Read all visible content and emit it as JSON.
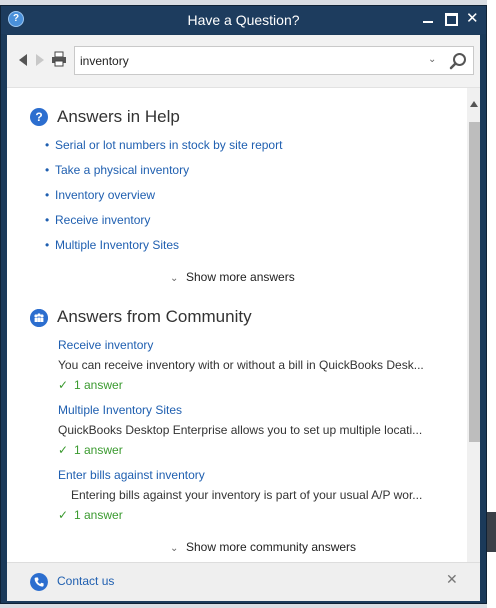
{
  "window": {
    "title": "Have a Question?",
    "app_icon": "?",
    "close_glyph": "✕"
  },
  "toolbar": {
    "search_value": "inventory",
    "dropdown_glyph": "⌄"
  },
  "help": {
    "icon": "?",
    "title": "Answers in Help",
    "bullet": "•",
    "items": [
      {
        "label": "Serial or lot numbers in stock by site report"
      },
      {
        "label": "Take a physical inventory"
      },
      {
        "label": "Inventory overview"
      },
      {
        "label": "Receive inventory"
      },
      {
        "label": "Multiple Inventory Sites"
      }
    ],
    "show_more": "Show more answers"
  },
  "community": {
    "title": "Answers from Community",
    "answer_check": "✓",
    "items": [
      {
        "title": "Receive inventory",
        "snippet": "You can receive inventory with or without a bill in QuickBooks Desk...",
        "answers": "1 answer"
      },
      {
        "title": "Multiple Inventory Sites",
        "snippet": "QuickBooks Desktop Enterprise allows you to set up multiple locati...",
        "answers": "1 answer"
      },
      {
        "title": "Enter bills against inventory",
        "snippet": "Entering bills against your inventory is part of your usual A/P wor...",
        "answers": "1 answer"
      }
    ],
    "show_more": "Show more community answers"
  },
  "chevron_glyph": "⌄",
  "footer": {
    "contact_label": "Contact us",
    "close_glyph": "✕"
  },
  "colors": {
    "titlebar": "#1d3c5e",
    "link": "#1f5fb0",
    "accent_icon": "#2c6ecf",
    "answer_green": "#3a9a2f"
  },
  "icons": [
    "back-arrow-icon",
    "forward-arrow-icon",
    "print-icon",
    "search-icon",
    "question-icon",
    "community-icon",
    "phone-icon",
    "close-icon",
    "chevron-down-icon",
    "check-icon"
  ]
}
